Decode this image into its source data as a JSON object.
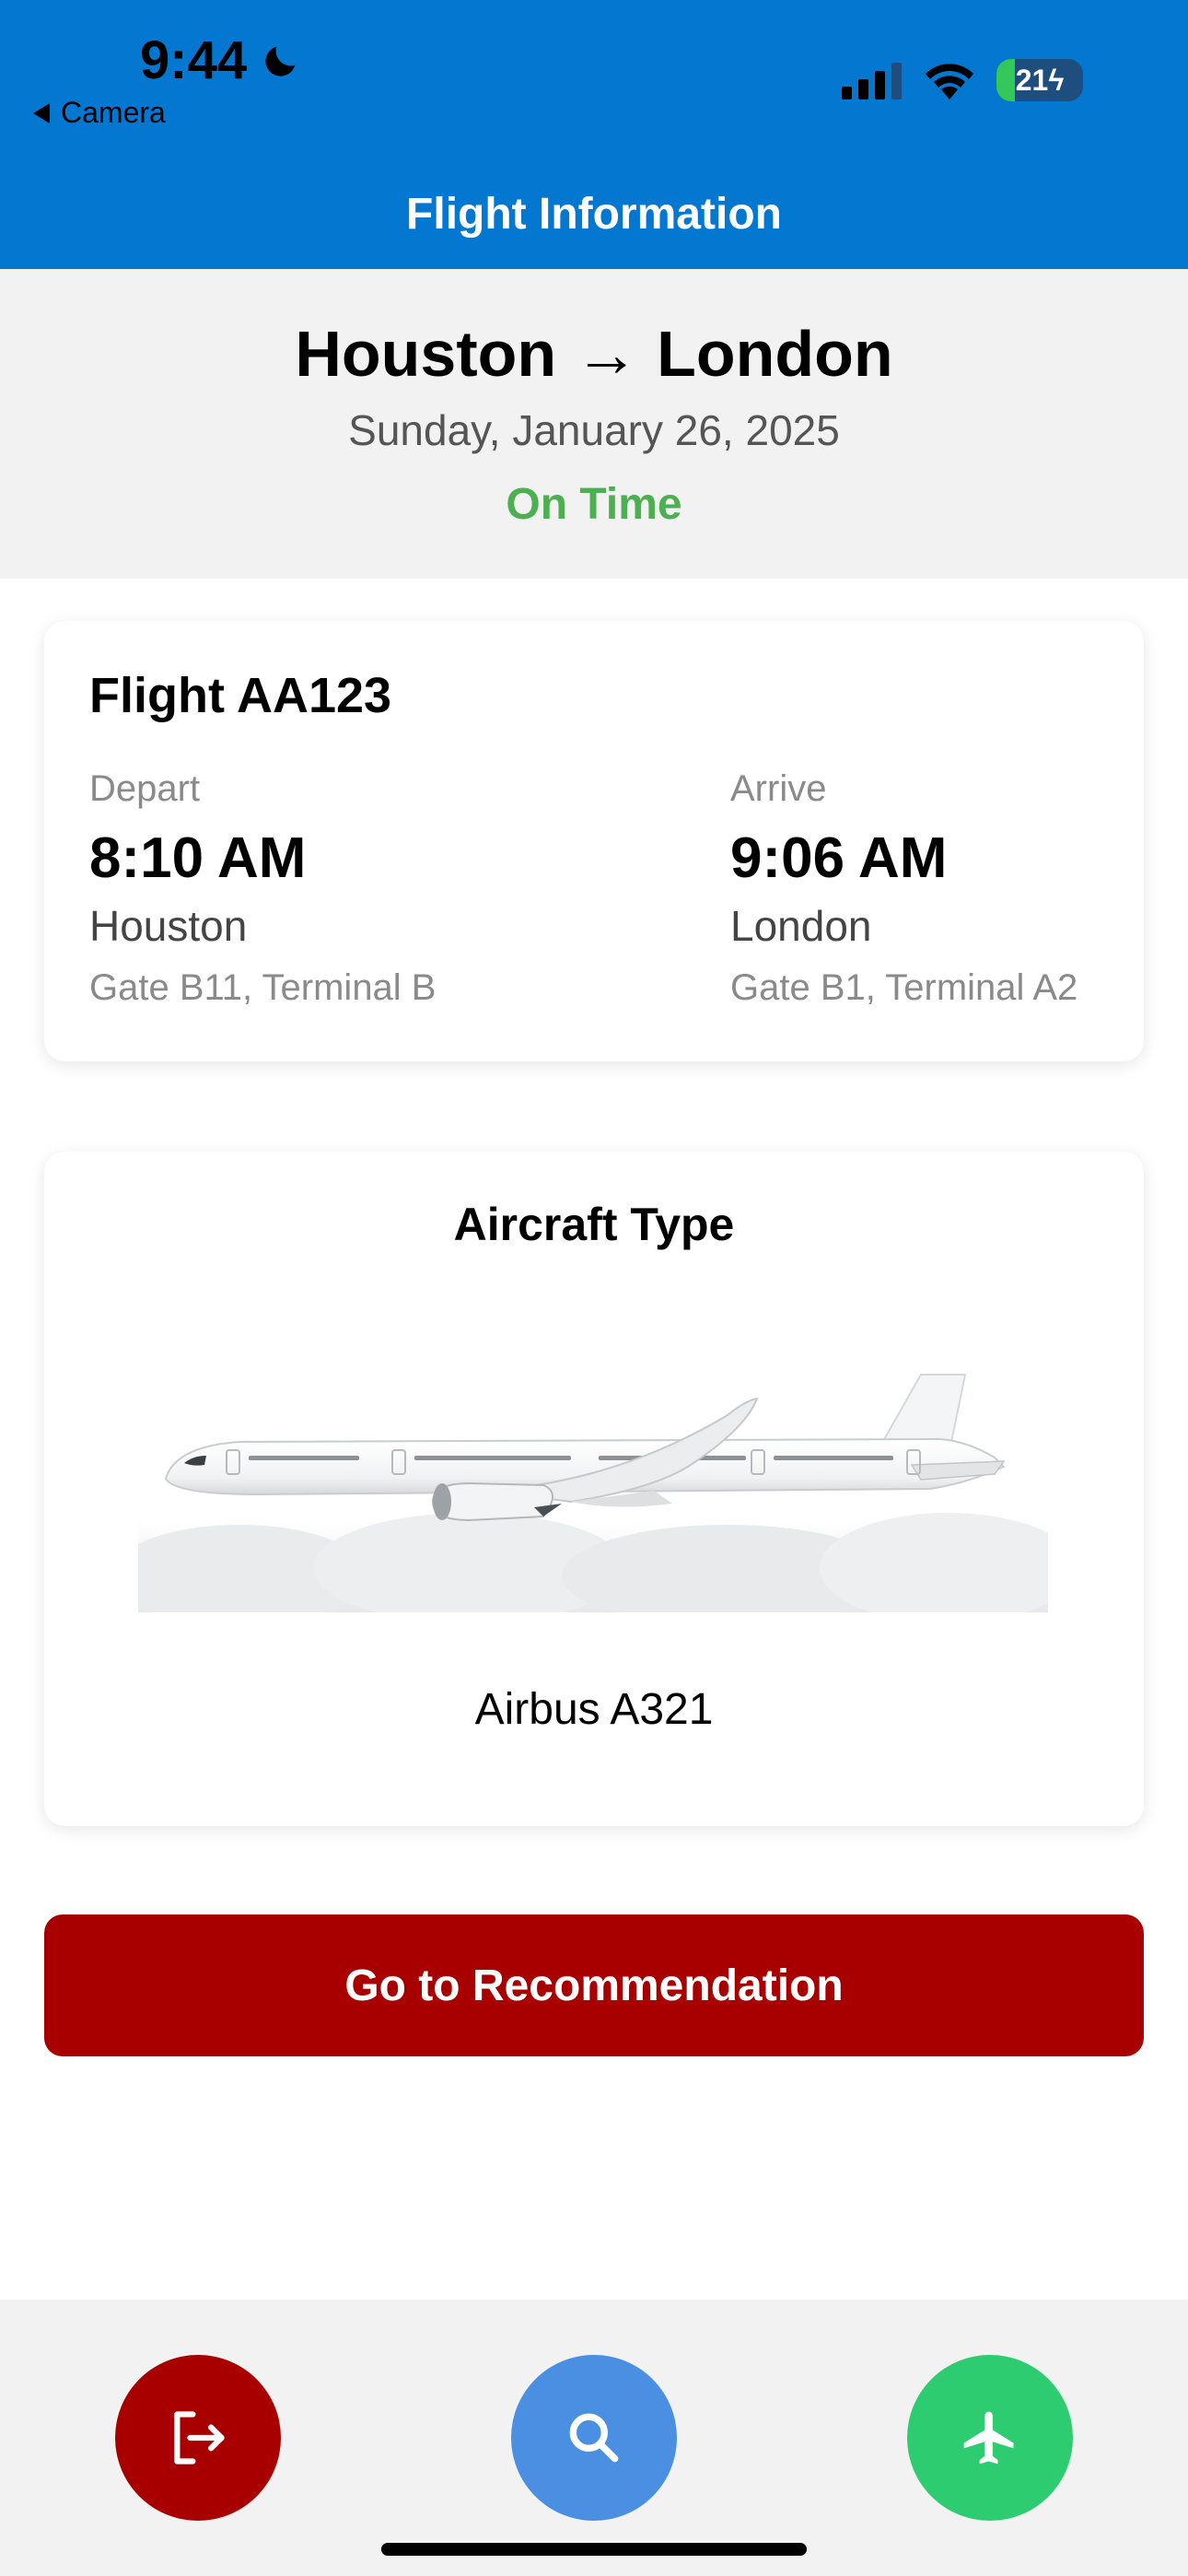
{
  "status_bar": {
    "time": "9:44",
    "back_label": "Camera",
    "battery_level": "21",
    "battery_fraction": 0.21
  },
  "header": {
    "title": "Flight Information",
    "background_color": "#0477D1"
  },
  "summary": {
    "route": "Houston → London",
    "date": "Sunday, January 26, 2025",
    "status": "On Time",
    "status_color": "#4CAF50"
  },
  "flight_card": {
    "flight_number": "Flight AA123",
    "depart": {
      "label": "Depart",
      "time": "8:10 AM",
      "city": "Houston",
      "gate": "Gate B11, Terminal B"
    },
    "arrive": {
      "label": "Arrive",
      "time": "9:06 AM",
      "city": "London",
      "gate": "Gate B1, Terminal A2"
    }
  },
  "aircraft_card": {
    "title": "Aircraft Type",
    "image_icon": "airplane-illustration",
    "aircraft_name": "Airbus A321"
  },
  "cta": {
    "label": "Go to Recommendation",
    "color": "#A80000"
  },
  "bottom_nav": {
    "buttons": [
      {
        "icon": "logout-icon",
        "color": "#A80000"
      },
      {
        "icon": "search-icon",
        "color": "#4A8FE2"
      },
      {
        "icon": "airplane-icon",
        "color": "#2ECC71"
      }
    ]
  }
}
